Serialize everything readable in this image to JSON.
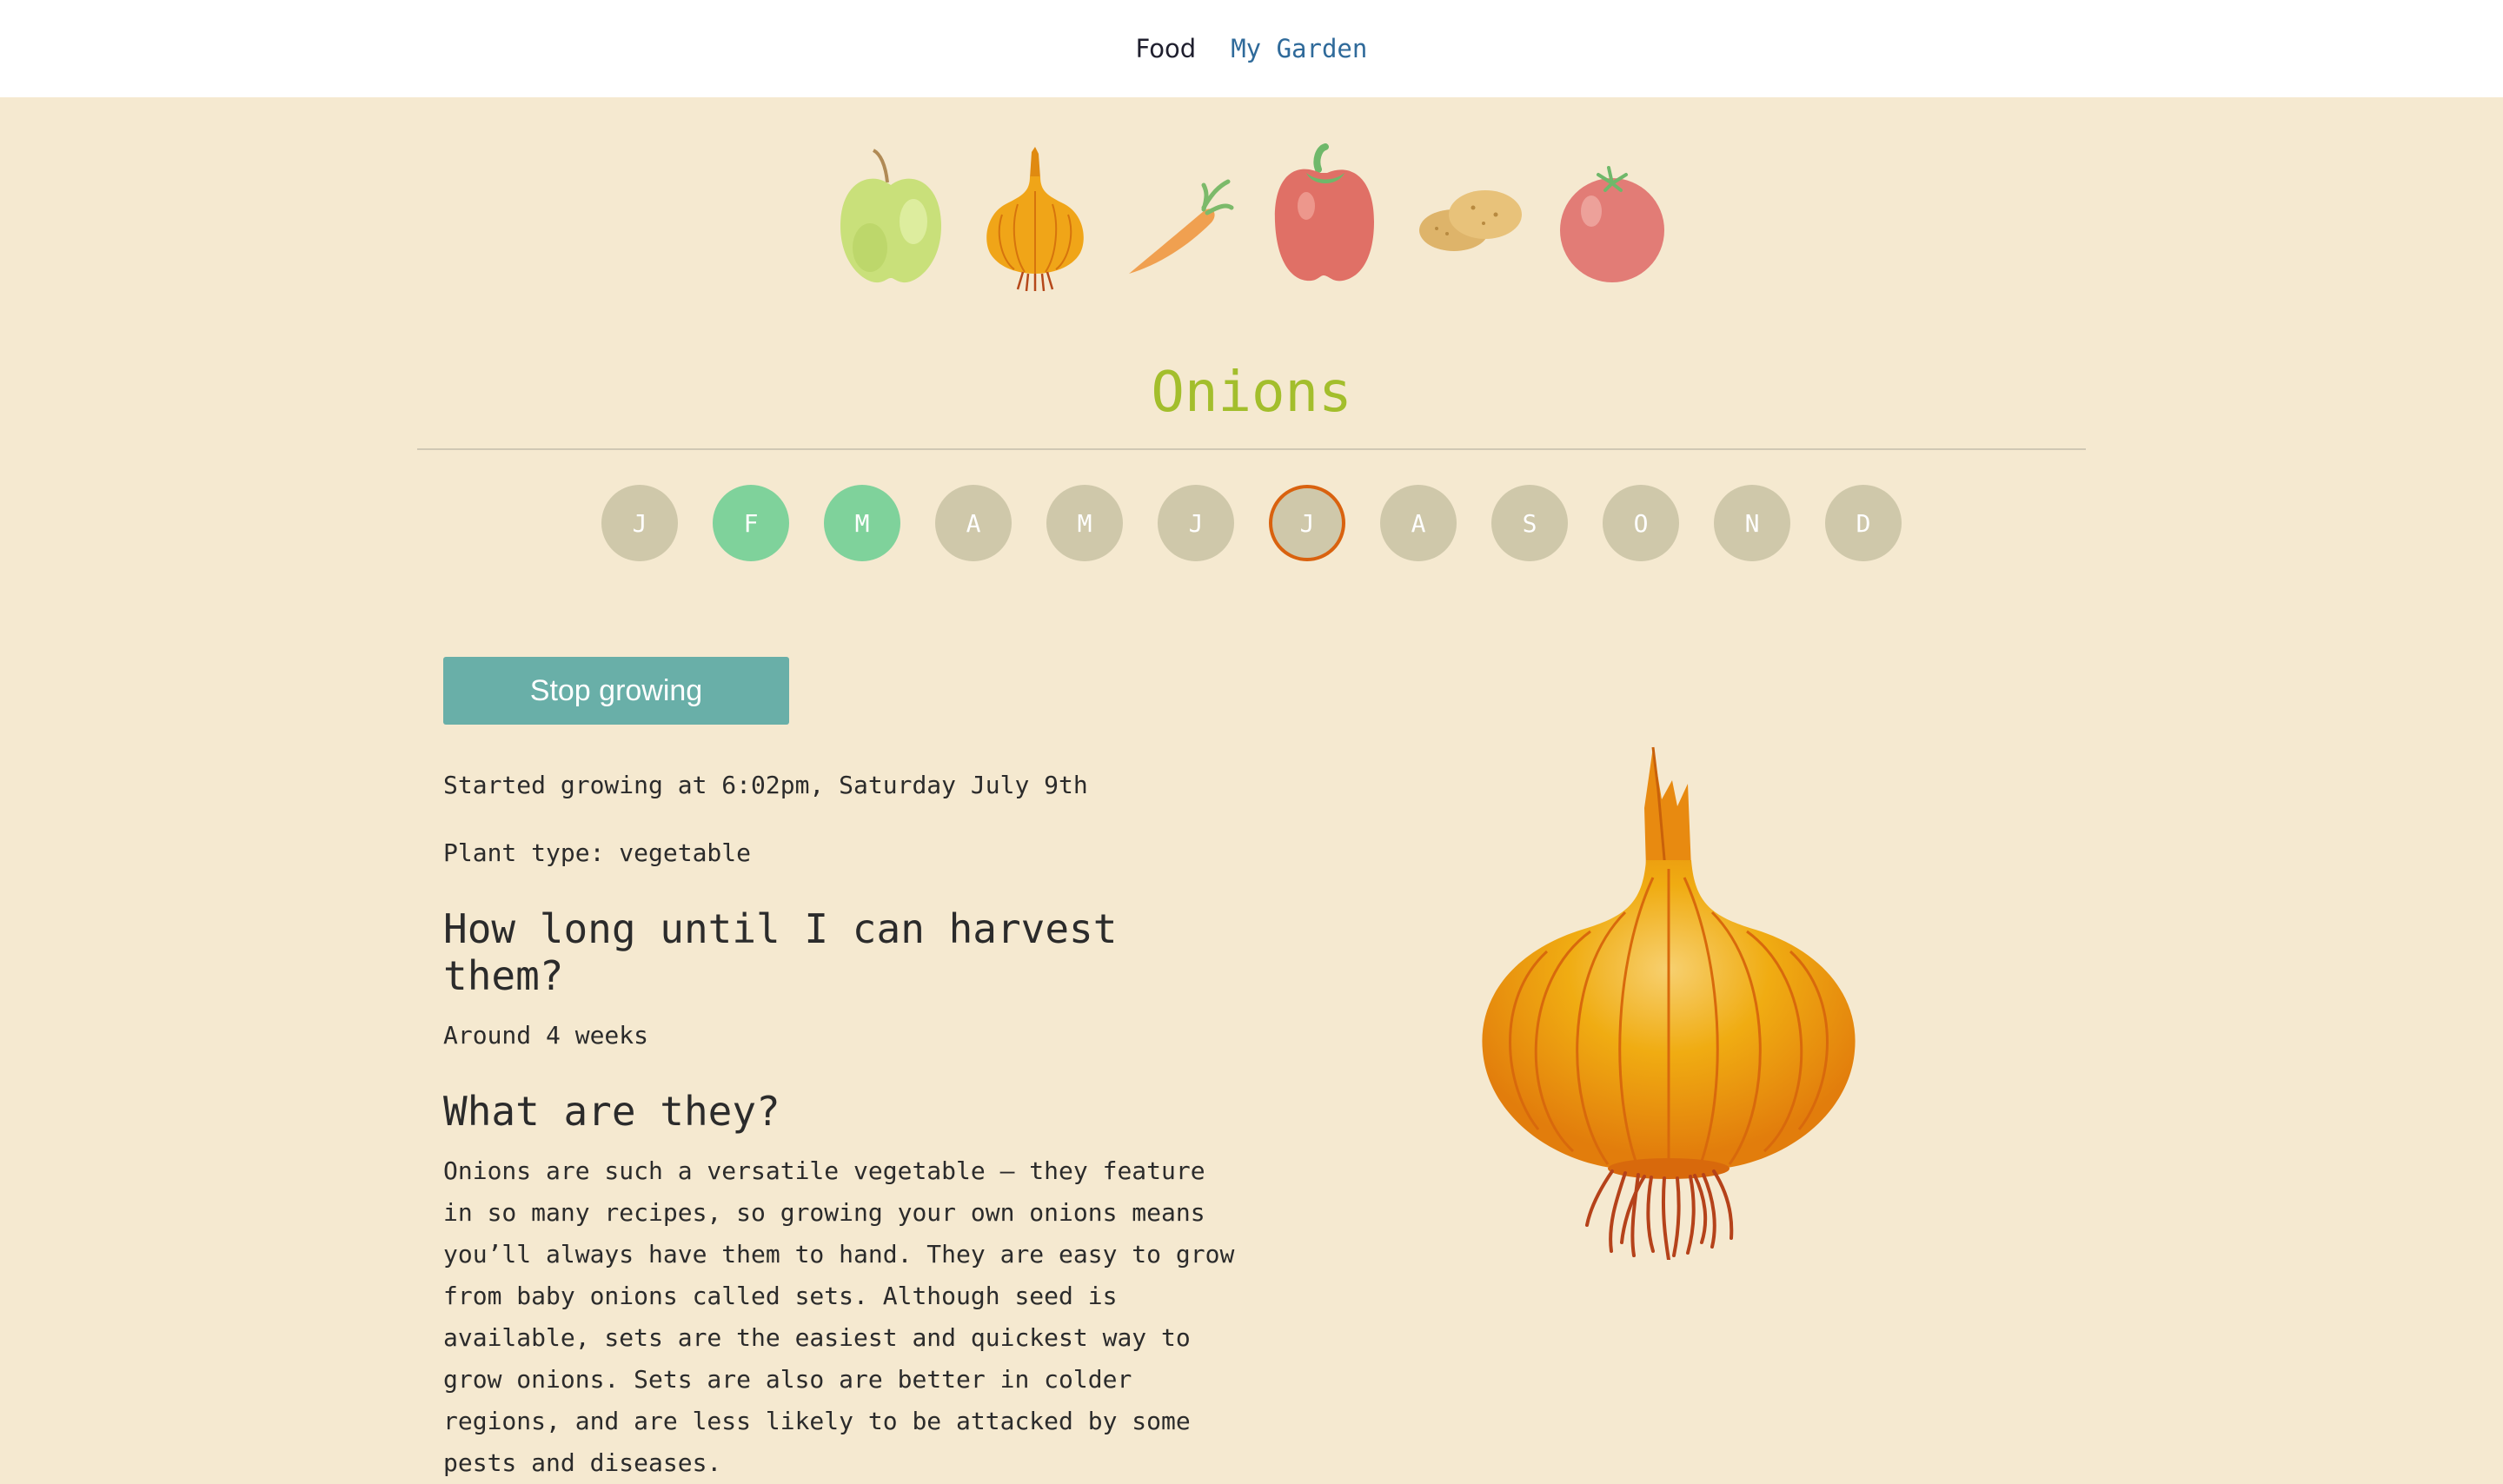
{
  "nav": {
    "food": "Food",
    "garden": "My Garden"
  },
  "foods": [
    {
      "name": "apple-icon"
    },
    {
      "name": "onion-icon"
    },
    {
      "name": "carrot-icon"
    },
    {
      "name": "pepper-icon"
    },
    {
      "name": "potato-icon"
    },
    {
      "name": "tomato-icon"
    }
  ],
  "title": "Onions",
  "months": [
    "J",
    "F",
    "M",
    "A",
    "M",
    "J",
    "J",
    "A",
    "S",
    "O",
    "N",
    "D"
  ],
  "planting_months": [
    "F",
    "M"
  ],
  "current_month_index": 6,
  "stop_button": "Stop growing",
  "started": "Started growing at 6:02pm, Saturday July 9th",
  "plant_type": "Plant type: vegetable",
  "harvest_heading": "How long until I can harvest them?",
  "harvest_text": "Around 4 weeks",
  "what_heading": "What are they?",
  "what_text": "Onions are such a versatile vegetable – they feature in so many recipes, so growing your own onions means you’ll always have them to hand. They are easy to grow from baby onions called sets. Although seed is available, sets are the easiest and quickest way to grow onions. Sets are also are better in colder regions, and are less likely to be attacked by some pests and diseases.",
  "colors": {
    "accent_title": "#a3be2c",
    "planting": "#7fd29b",
    "month_default": "#cfc8aa",
    "current_ring": "#d9620f",
    "button": "#69afa8",
    "background": "#f5e9d0"
  }
}
